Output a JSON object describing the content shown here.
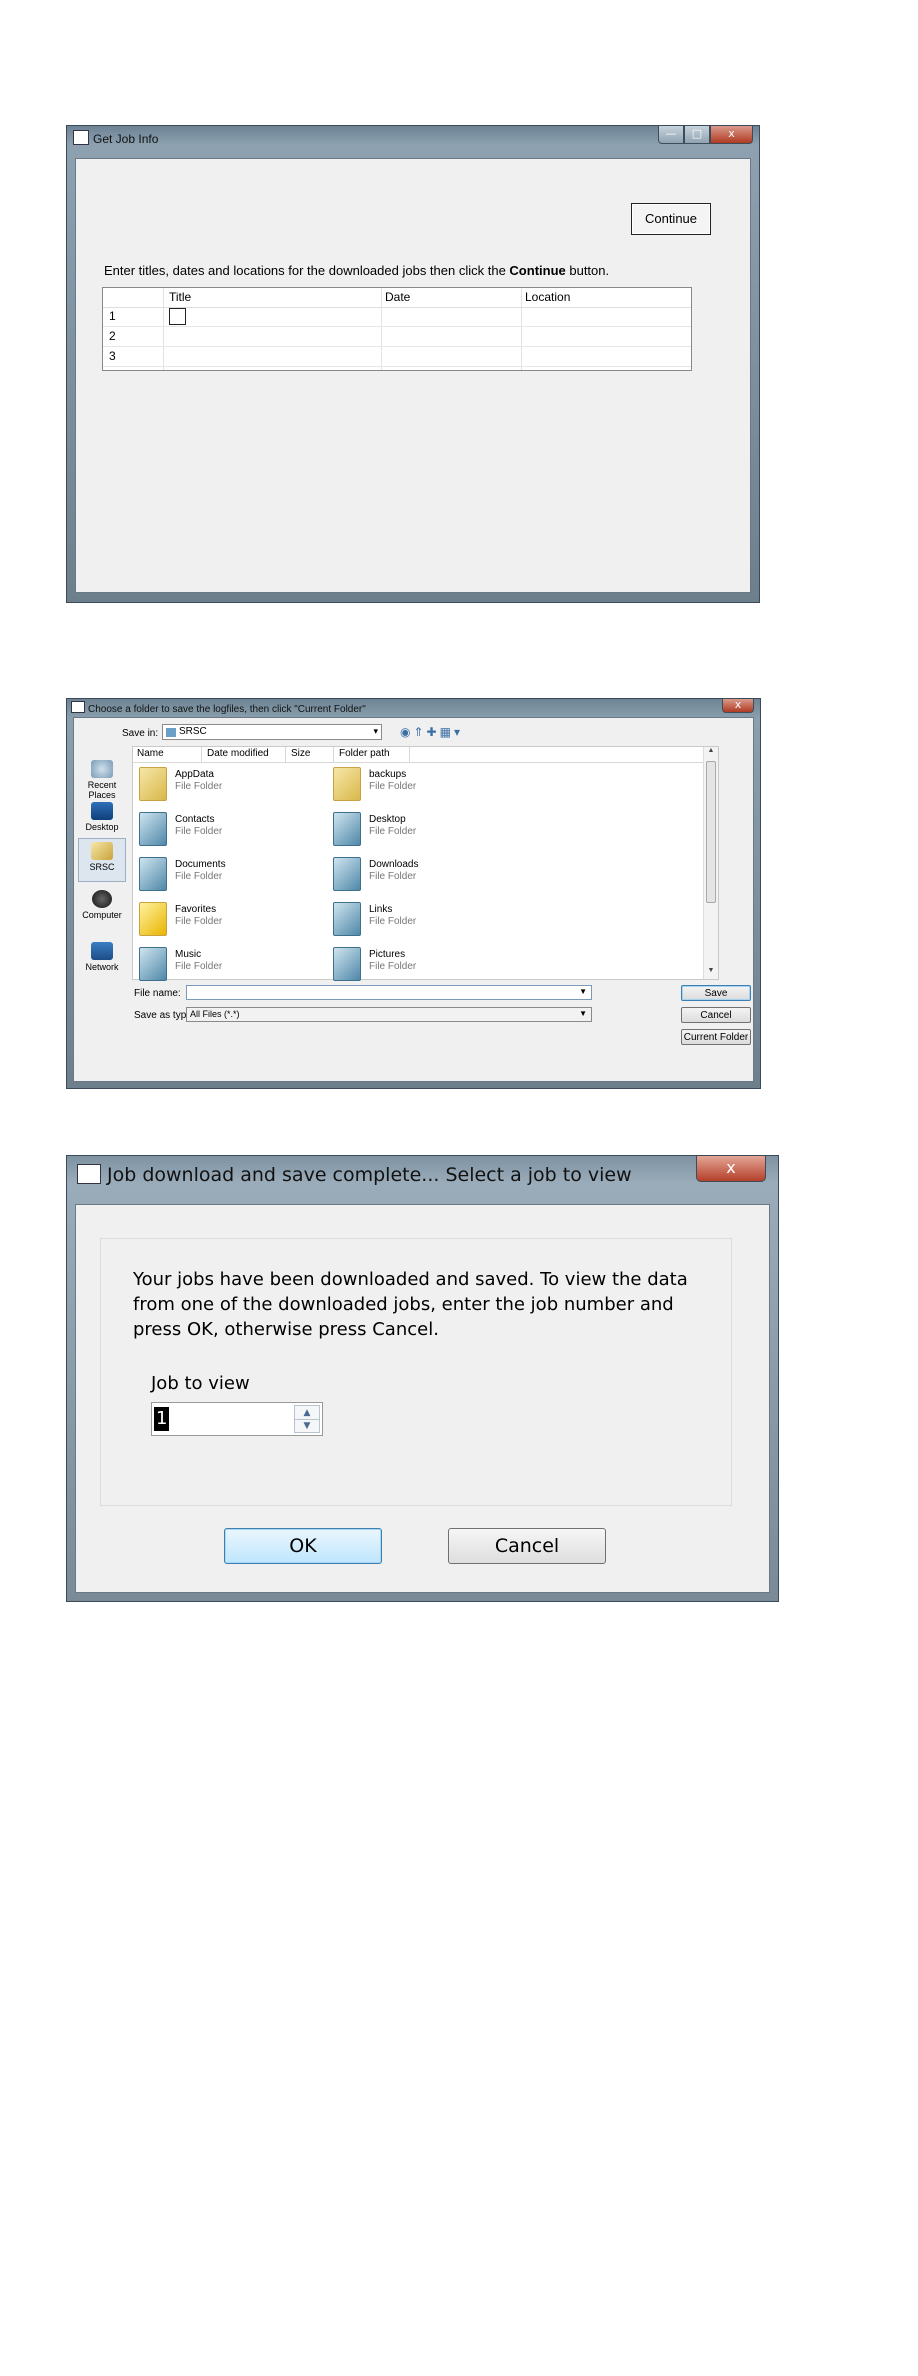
{
  "window1": {
    "title": "Get Job Info",
    "caption_min": "—",
    "caption_max": "□",
    "caption_close": "x",
    "continue_label": "Continue",
    "instruction_prefix": "Enter titles, dates and locations for the downloaded jobs then click the ",
    "instruction_bold": "Continue",
    "instruction_suffix": " button.",
    "table": {
      "columns": [
        "Title",
        "Date",
        "Location"
      ],
      "rows": [
        "1",
        "2",
        "3"
      ]
    }
  },
  "window2": {
    "title": "Choose a folder to save the logfiles, then click \"Current Folder\"",
    "caption_close": "x",
    "save_in_label": "Save in:",
    "save_in_value": "SRSC",
    "places": [
      "Recent Places",
      "Desktop",
      "SRSC",
      "Computer",
      "Network"
    ],
    "selected_place": "SRSC",
    "columns": [
      "Name",
      "Date modified",
      "Size",
      "Folder path"
    ],
    "items": [
      {
        "name": "AppData",
        "type": "File Folder"
      },
      {
        "name": "backups",
        "type": "File Folder"
      },
      {
        "name": "Contacts",
        "type": "File Folder"
      },
      {
        "name": "Desktop",
        "type": "File Folder"
      },
      {
        "name": "Documents",
        "type": "File Folder"
      },
      {
        "name": "Downloads",
        "type": "File Folder"
      },
      {
        "name": "Favorites",
        "type": "File Folder"
      },
      {
        "name": "Links",
        "type": "File Folder"
      },
      {
        "name": "Music",
        "type": "File Folder"
      },
      {
        "name": "Pictures",
        "type": "File Folder"
      }
    ],
    "file_name_label": "File name:",
    "file_name_value": "",
    "save_as_type_label": "Save as type:",
    "save_as_type_value": "All Files (*.*)",
    "save_label": "Save",
    "cancel_label": "Cancel",
    "current_folder_label": "Current Folder"
  },
  "window3": {
    "title": "Job download and save complete... Select a job to view",
    "caption_close": "x",
    "message": "Your jobs have been downloaded and saved.  To view the data from one of the downloaded jobs, enter the job number and press OK, otherwise press Cancel.",
    "job_to_view_label": "Job to view",
    "job_to_view_value": "1",
    "ok_label": "OK",
    "cancel_label": "Cancel"
  }
}
